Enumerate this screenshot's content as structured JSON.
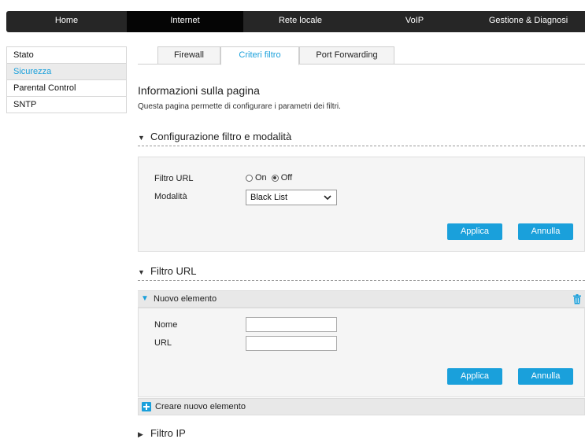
{
  "topnav": {
    "items": [
      {
        "label": "Home"
      },
      {
        "label": "Internet"
      },
      {
        "label": "Rete locale"
      },
      {
        "label": "VoIP"
      },
      {
        "label": "Gestione & Diagnosi"
      }
    ],
    "active": "Internet"
  },
  "sidebar": {
    "items": [
      {
        "label": "Stato"
      },
      {
        "label": "Sicurezza"
      },
      {
        "label": "Parental Control"
      },
      {
        "label": "SNTP"
      }
    ],
    "active": "Sicurezza"
  },
  "tabs": {
    "items": [
      {
        "label": "Firewall"
      },
      {
        "label": "Criteri filtro"
      },
      {
        "label": "Port Forwarding"
      }
    ],
    "active": "Criteri filtro"
  },
  "page": {
    "title": "Informazioni sulla pagina",
    "description": "Questa pagina permette di configurare i parametri dei filtri."
  },
  "config_section": {
    "title": "Configurazione filtro e modalità",
    "filtro_url_label": "Filtro URL",
    "radio_on": "On",
    "radio_off": "Off",
    "selected": "Off",
    "modalita_label": "Modalità",
    "modalita_value": "Black List",
    "apply_label": "Applica",
    "cancel_label": "Annulla"
  },
  "url_section": {
    "title": "Filtro URL",
    "item_title": "Nuovo elemento",
    "nome_label": "Nome",
    "url_label": "URL",
    "nome_value": "",
    "url_value": "",
    "apply_label": "Applica",
    "cancel_label": "Annulla",
    "new_item_label": "Creare nuovo elemento"
  },
  "ip_section": {
    "title": "Filtro IP"
  },
  "colors": {
    "accent": "#1aa0db",
    "nav_bg": "#262626",
    "nav_active": "#050505"
  },
  "icons": {
    "expanded": "triangle-down-icon",
    "collapsed": "triangle-right-icon",
    "delete": "trash-icon",
    "add": "plus-icon",
    "dropdown": "chevron-down-icon"
  }
}
